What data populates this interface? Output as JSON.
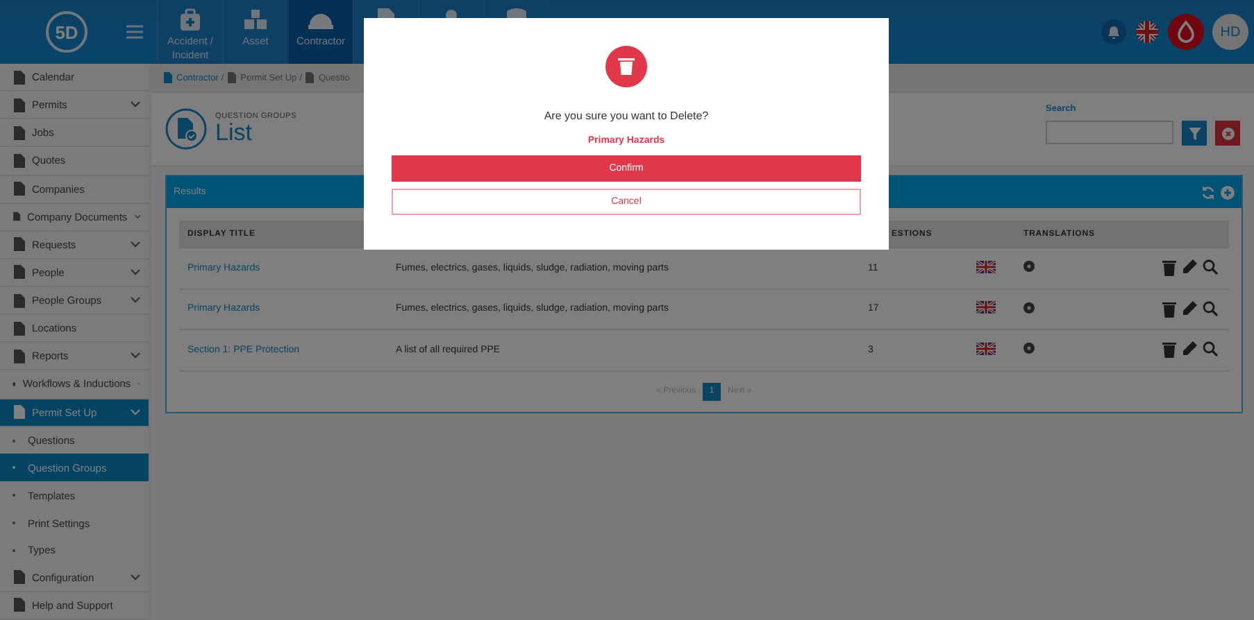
{
  "logo": {
    "text": "5D"
  },
  "nav_tabs": [
    {
      "label": "Accident / Incident",
      "selected": false
    },
    {
      "label": "Asset",
      "selected": false
    },
    {
      "label": "Contractor",
      "selected": true
    },
    {
      "selected": false
    },
    {
      "selected": false
    },
    {
      "selected": false
    }
  ],
  "user": {
    "initials": "HD"
  },
  "sidebar": {
    "items": [
      {
        "label": "Calendar",
        "has_submenu": false,
        "selected": false
      },
      {
        "label": "Permits",
        "has_submenu": true,
        "selected": false
      },
      {
        "label": "Jobs",
        "has_submenu": false,
        "selected": false
      },
      {
        "label": "Quotes",
        "has_submenu": false,
        "selected": false
      },
      {
        "label": "Companies",
        "has_submenu": false,
        "selected": false
      },
      {
        "label": "Company Documents",
        "has_submenu": true,
        "selected": false
      },
      {
        "label": "Requests",
        "has_submenu": true,
        "selected": false
      },
      {
        "label": "People",
        "has_submenu": true,
        "selected": false
      },
      {
        "label": "People Groups",
        "has_submenu": true,
        "selected": false
      },
      {
        "label": "Locations",
        "has_submenu": false,
        "selected": false
      },
      {
        "label": "Reports",
        "has_submenu": true,
        "selected": false
      },
      {
        "label": "Workflows & Inductions",
        "has_submenu": true,
        "selected": false
      },
      {
        "label": "Permit Set Up",
        "has_submenu": true,
        "selected": true,
        "children": [
          {
            "label": "Questions",
            "selected": false
          },
          {
            "label": "Question Groups",
            "selected": true
          },
          {
            "label": "Templates",
            "selected": false
          },
          {
            "label": "Print Settings",
            "selected": false
          },
          {
            "label": "Types",
            "selected": false
          }
        ]
      },
      {
        "label": "Configuration",
        "has_submenu": true,
        "selected": false
      },
      {
        "label": "Help and Support",
        "has_submenu": false,
        "selected": false
      }
    ]
  },
  "breadcrumb": [
    {
      "label": "Contractor"
    },
    {
      "separator": "/",
      "label": "Permit Set Up"
    },
    {
      "separator": "/",
      "label": "Questio"
    }
  ],
  "page_header": {
    "subtitle": "QUESTION GROUPS",
    "title": "List"
  },
  "search": {
    "label": "Search"
  },
  "results": {
    "title": "Results",
    "columns": [
      "DISPLAY TITLE",
      "ESTIONS",
      "TRANSLATIONS"
    ],
    "rows": [
      {
        "title": "Primary Hazards",
        "description": "Fumes, electrics, gases, liquids, sludge, radiation, moving parts",
        "questions": "11"
      },
      {
        "title": "Primary Hazards",
        "description": "Fumes, electrics, gases, liquids, sludge, radiation, moving parts",
        "questions": "17"
      },
      {
        "title": "Section 1: PPE Protection",
        "description": "A list of all required PPE",
        "questions": "3"
      }
    ],
    "pagination": {
      "previous": "« Previous",
      "next": "Next »",
      "pages": [
        {
          "label": "1",
          "selected": true
        }
      ]
    }
  },
  "dialog": {
    "message": "Are you sure you want to Delete?",
    "item": "Primary Hazards",
    "confirm": "Confirm",
    "cancel": "Cancel"
  }
}
